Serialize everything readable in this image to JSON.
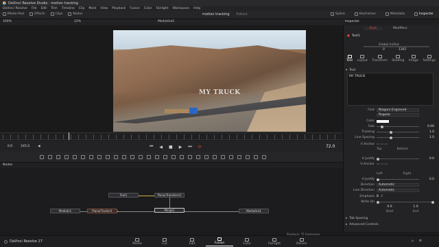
{
  "app": {
    "title": "DaVinci Resolve Studio - motion tracking",
    "menu": [
      "DaVinci Resolve",
      "File",
      "Edit",
      "Trim",
      "Timeline",
      "Clip",
      "Mark",
      "View",
      "Playback",
      "Fusion",
      "Color",
      "Fairlight",
      "Workspace",
      "Help"
    ]
  },
  "toolbar": {
    "left": [
      "Media Pool",
      "Effects",
      "Clips",
      "Nodes"
    ],
    "project": "motion tracking",
    "edited": "Edited",
    "right": [
      "Spline",
      "Keyframes",
      "Metadata",
      "Inspector"
    ]
  },
  "viewer": {
    "zoom": "100%",
    "fit": "22%",
    "title": "MediaOut1",
    "overlay_text": "MY TRUCK",
    "timecode_left": "0.0",
    "timecode_mid": "245.0",
    "timecode_right": "72.0"
  },
  "nodes": {
    "title": "Nodes",
    "text1": "Text1",
    "planar_transform": "PlanarTransform1",
    "media_in": "MediaIn1",
    "planar_tracker": "PlanarTracker1",
    "merge": "Merge1",
    "media_out": "MediaOut1"
  },
  "status": {
    "playback": "Playback: 75 frames/sec"
  },
  "bottom": {
    "brand": "DaVinci Resolve 17",
    "pages": [
      "Media",
      "Cut",
      "Edit",
      "Fusion",
      "Color",
      "Fairlight",
      "Deliver"
    ],
    "active_page": "Fusion"
  },
  "inspector": {
    "title": "Inspector",
    "tabs": [
      "Tools",
      "Modifiers"
    ],
    "node_name": "Text1",
    "global_in_out_label": "Global In/Out",
    "global_in": "0",
    "global_out": "1365",
    "subtabs": [
      "Text",
      "Layout",
      "Transform",
      "Shading",
      "Image",
      "Settings"
    ],
    "section": "Text",
    "text_value": "MY TRUCK",
    "font": "Niagara Engraved",
    "style": "Regular",
    "labels": {
      "font": "Font",
      "color": "Color",
      "size": "Size",
      "tracking": "Tracking",
      "line_spacing": "Line Spacing",
      "v_anchor": "V Anchor",
      "v_justify": "V Justify",
      "h_anchor": "H Anchor",
      "h_justify": "H Justify",
      "direction": "Direction",
      "line_direction": "Line Direction",
      "emphasis": "Emphasis",
      "write_on": "Write On"
    },
    "size": "0.06",
    "tracking": "1.0",
    "line_spacing": "1.0",
    "v_anchor_top": "Top",
    "v_anchor_bottom": "Bottom",
    "v_justify": "0.0",
    "h_anchor_left": "Left",
    "h_anchor_right": "Right",
    "h_justify": "0.0",
    "direction": "Automatic",
    "line_direction": "Automatic",
    "write_on_start": "0.0",
    "write_on_end": "1.0",
    "write_on_start_label": "Start",
    "write_on_end_label": "End",
    "tab_spacing": "Tab Spacing",
    "advanced_controls": "Advanced Controls"
  },
  "colors": {
    "accent": "#e0483d",
    "text_color": "#ffffff"
  }
}
